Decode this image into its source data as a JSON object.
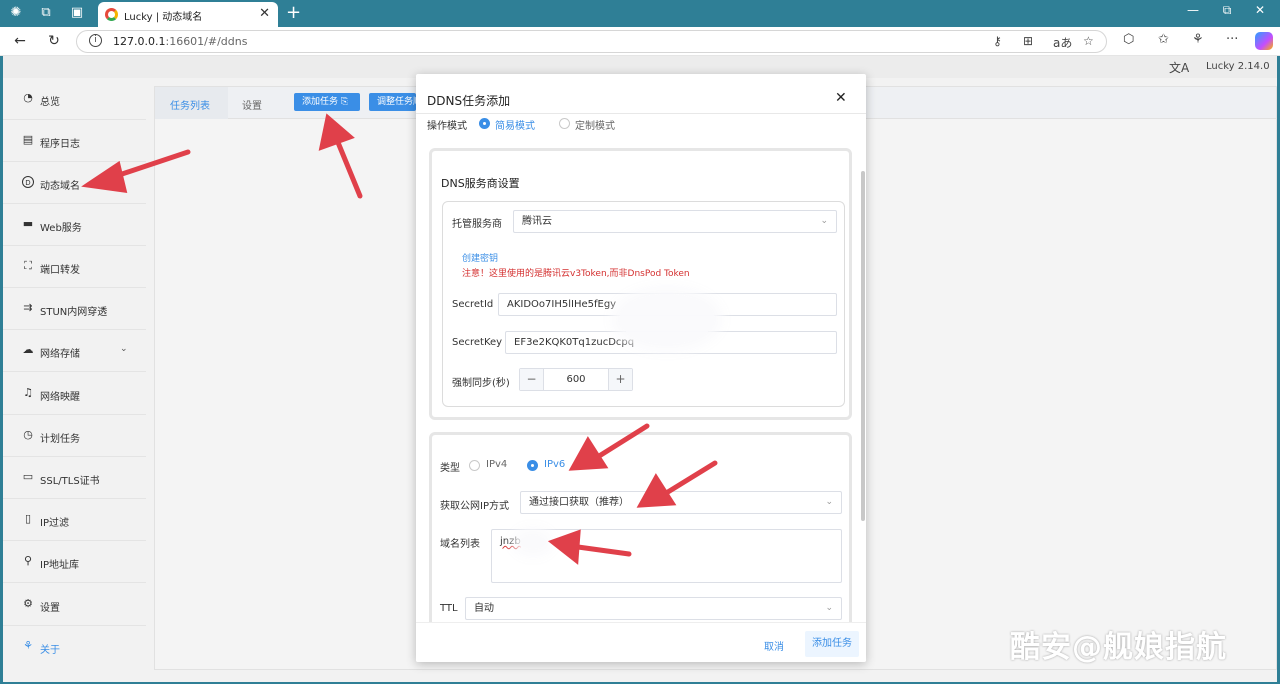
{
  "browser": {
    "tab_title": "Lucky | 动态域名",
    "url_host": "127.0.0.1",
    "url_rest": ":16601/#/ddns"
  },
  "app": {
    "version": "Lucky 2.14.0",
    "lang_icon": "文A"
  },
  "sidebar": {
    "items": [
      {
        "label": "总览",
        "icon": "dashboard-icon"
      },
      {
        "label": "程序日志",
        "icon": "log-icon"
      },
      {
        "label": "动态域名",
        "icon": "dns-icon"
      },
      {
        "label": "Web服务",
        "icon": "web-icon"
      },
      {
        "label": "端口转发",
        "icon": "port-forward-icon"
      },
      {
        "label": "STUN内网穿透",
        "icon": "stun-icon"
      },
      {
        "label": "网络存储",
        "icon": "storage-icon"
      },
      {
        "label": "网络映醒",
        "icon": "wake-icon"
      },
      {
        "label": "计划任务",
        "icon": "schedule-icon"
      },
      {
        "label": "SSL/TLS证书",
        "icon": "cert-icon"
      },
      {
        "label": "IP过滤",
        "icon": "filter-icon"
      },
      {
        "label": "IP地址库",
        "icon": "ip-db-icon"
      },
      {
        "label": "设置",
        "icon": "gear-icon"
      },
      {
        "label": "关于",
        "icon": "about-icon"
      }
    ]
  },
  "content": {
    "tab_task_list": "任务列表",
    "tab_settings": "设置",
    "btn_add_task": "添加任务",
    "btn_adjust": "调整任务顺"
  },
  "dialog": {
    "title": "DDNS任务添加",
    "mode_label": "操作模式",
    "mode_simple": "简易模式",
    "mode_custom": "定制模式",
    "dns_section_title": "DNS服务商设置",
    "provider_label": "托管服务商",
    "provider_value": "腾讯云",
    "create_key_link": "创建密钥",
    "warning": "注意！这里使用的是腾讯云v3Token,而非DnsPod Token",
    "secret_id_label": "SecretId",
    "secret_id_value": "AKIDOo7IH5lIHe5fEgy",
    "secret_key_label": "SecretKey",
    "secret_key_value": "EF3e2KQK0Tq1zucDcpq",
    "sync_label": "强制同步(秒)",
    "sync_value": "600",
    "type_label": "类型",
    "type_ipv4": "IPv4",
    "type_ipv6": "IPv6",
    "ip_method_label": "获取公网IP方式",
    "ip_method_value": "通过接口获取（推荐）",
    "domain_list_label": "域名列表",
    "domain_list_value": "jnzb",
    "ttl_label": "TTL",
    "ttl_value": "自动",
    "cancel": "取消",
    "submit": "添加任务"
  },
  "watermark": "酷安@舰娘指航",
  "colors": {
    "accent": "#3a8ee6",
    "warning": "#d43030",
    "arrow": "#e0404a",
    "browser_bar": "#2f7f96"
  }
}
